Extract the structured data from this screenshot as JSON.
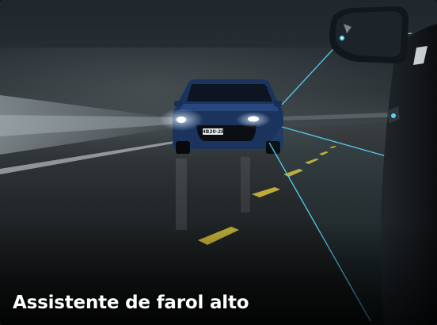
{
  "banner": {
    "caption": "Assistente de farol alto",
    "plate": "HB20·2E"
  },
  "colors": {
    "sensor_beam": "#5ad2f5",
    "car_body": "#1d3a6b",
    "headlight": "#eaf6ff",
    "lane_marking": "#d9c23a"
  },
  "icons": {
    "car": "front-facing-car-illustration",
    "mirror": "side-mirror-illustration"
  }
}
